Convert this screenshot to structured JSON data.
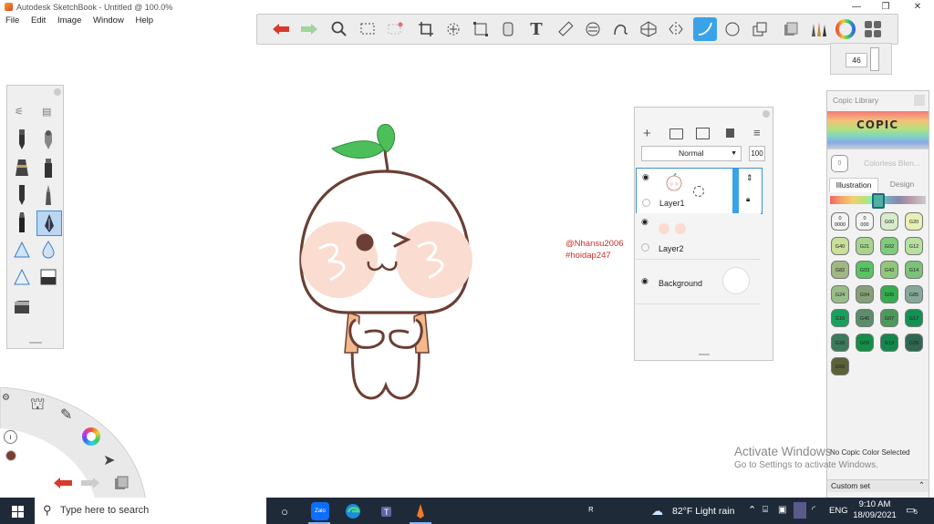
{
  "window": {
    "title": "Autodesk SketchBook - Untitled @ 100.0%",
    "minimize": "—",
    "maximize": "❐",
    "close": "✕"
  },
  "menu": [
    "File",
    "Edit",
    "Image",
    "Window",
    "Help"
  ],
  "toolbar": {
    "icons": [
      "undo-icon",
      "redo-icon",
      "zoom-icon",
      "select-rect-icon",
      "select-lasso-icon",
      "crop-icon",
      "transform-icon",
      "distort-icon",
      "fill-icon",
      "text-icon",
      "ruler-icon",
      "ellipse-guide-icon",
      "french-curve-icon",
      "perspective-icon",
      "symmetry-icon",
      "stroke-icon",
      "shape-icon",
      "copy-icon",
      "layer-icon",
      "brush-library-icon",
      "color-wheel-icon",
      "ui-icon"
    ],
    "selected": "stroke-icon",
    "brush_size": "46"
  },
  "brush_palette": {
    "items": [
      "pencil-icon",
      "airbrush-icon",
      "ink-pen-icon",
      "marker-icon",
      "ballpoint-icon",
      "paint-brush-icon",
      "felt-pen-icon",
      "calligraphy-pen-icon",
      "blur-icon",
      "water-drop-icon",
      "smudge-icon",
      "eraser-block-icon",
      "eraser-icon"
    ],
    "selected": "calligraphy-pen-icon"
  },
  "layers": {
    "blend_mode": "Normal",
    "opacity": "100",
    "items": [
      {
        "name": "Layer1",
        "selected": true
      },
      {
        "name": "Layer2",
        "selected": false
      },
      {
        "name": "Background",
        "selected": false
      }
    ]
  },
  "credit": {
    "line1": "@Nhansu2006",
    "line2": "#hoidap247"
  },
  "copic": {
    "title": "Copic Library",
    "logo": "COPIC",
    "colorless": "0",
    "colorless_label": "Colorless Blen...",
    "tabs": [
      "Illustration",
      "Design"
    ],
    "active_tab": "Illustration",
    "swatches": [
      {
        "code": "0\n0000",
        "color": "#f3f3f3"
      },
      {
        "code": "0\n000",
        "color": "#f3f3f3"
      },
      {
        "code": "G00",
        "color": "#d8eccb"
      },
      {
        "code": "G20",
        "color": "#e9f0b6"
      },
      {
        "code": "G40",
        "color": "#c9df9a"
      },
      {
        "code": "G21",
        "color": "#a8d48e"
      },
      {
        "code": "G02",
        "color": "#7fcc7d"
      },
      {
        "code": "G12",
        "color": "#b7e0a1"
      },
      {
        "code": "G82",
        "color": "#a0b783"
      },
      {
        "code": "G03",
        "color": "#59c364"
      },
      {
        "code": "G43",
        "color": "#90c77c"
      },
      {
        "code": "G14",
        "color": "#7cc27a"
      },
      {
        "code": "G24",
        "color": "#98bd88"
      },
      {
        "code": "G94",
        "color": "#88a07a"
      },
      {
        "code": "G05",
        "color": "#34ad4f"
      },
      {
        "code": "G85",
        "color": "#86a898"
      },
      {
        "code": "G16",
        "color": "#1aa05d"
      },
      {
        "code": "G46",
        "color": "#5c8e6b"
      },
      {
        "code": "G07",
        "color": "#4c9a5b"
      },
      {
        "code": "G17",
        "color": "#129152"
      },
      {
        "code": "G28",
        "color": "#3b7a5c"
      },
      {
        "code": "G09",
        "color": "#138f47"
      },
      {
        "code": "G19",
        "color": "#14874c"
      },
      {
        "code": "G29",
        "color": "#2f6750"
      },
      {
        "code": "G99",
        "color": "#5b6138"
      }
    ],
    "status": "No Copic Color Selected",
    "footer": "Custom set"
  },
  "watermark": {
    "line1": "Activate Windows",
    "line2": "Go to Settings to activate Windows."
  },
  "taskbar": {
    "search_placeholder": "Type here to search",
    "weather": "82°F  Light rain",
    "lang": "ENG",
    "time": "9:10 AM",
    "date": "18/09/2021",
    "notifications": "5",
    "zalo": "Zalo"
  },
  "colors": {
    "accent": "#3aa3e8",
    "outline": "#6b3f35",
    "cheek": "#fbdcd0",
    "leaf": "#4cbf5b",
    "credit": "#d0302a",
    "taskbar": "#1f2a38"
  }
}
